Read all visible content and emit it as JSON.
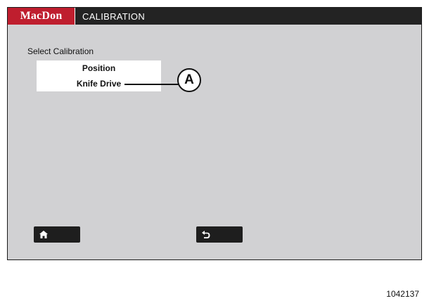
{
  "header": {
    "brand": "MacDon",
    "title": "CALIBRATION",
    "brand_color": "#bf1e2e",
    "bar_color": "#232323"
  },
  "main": {
    "select_label": "Select Calibration",
    "items": [
      {
        "label": "Position"
      },
      {
        "label": "Knife Drive"
      }
    ],
    "background": "#d1d1d3"
  },
  "callout": {
    "letter": "A"
  },
  "footer": {
    "home_icon": "home-icon",
    "back_icon": "back-arrow-icon"
  },
  "figure_number": "1042137"
}
